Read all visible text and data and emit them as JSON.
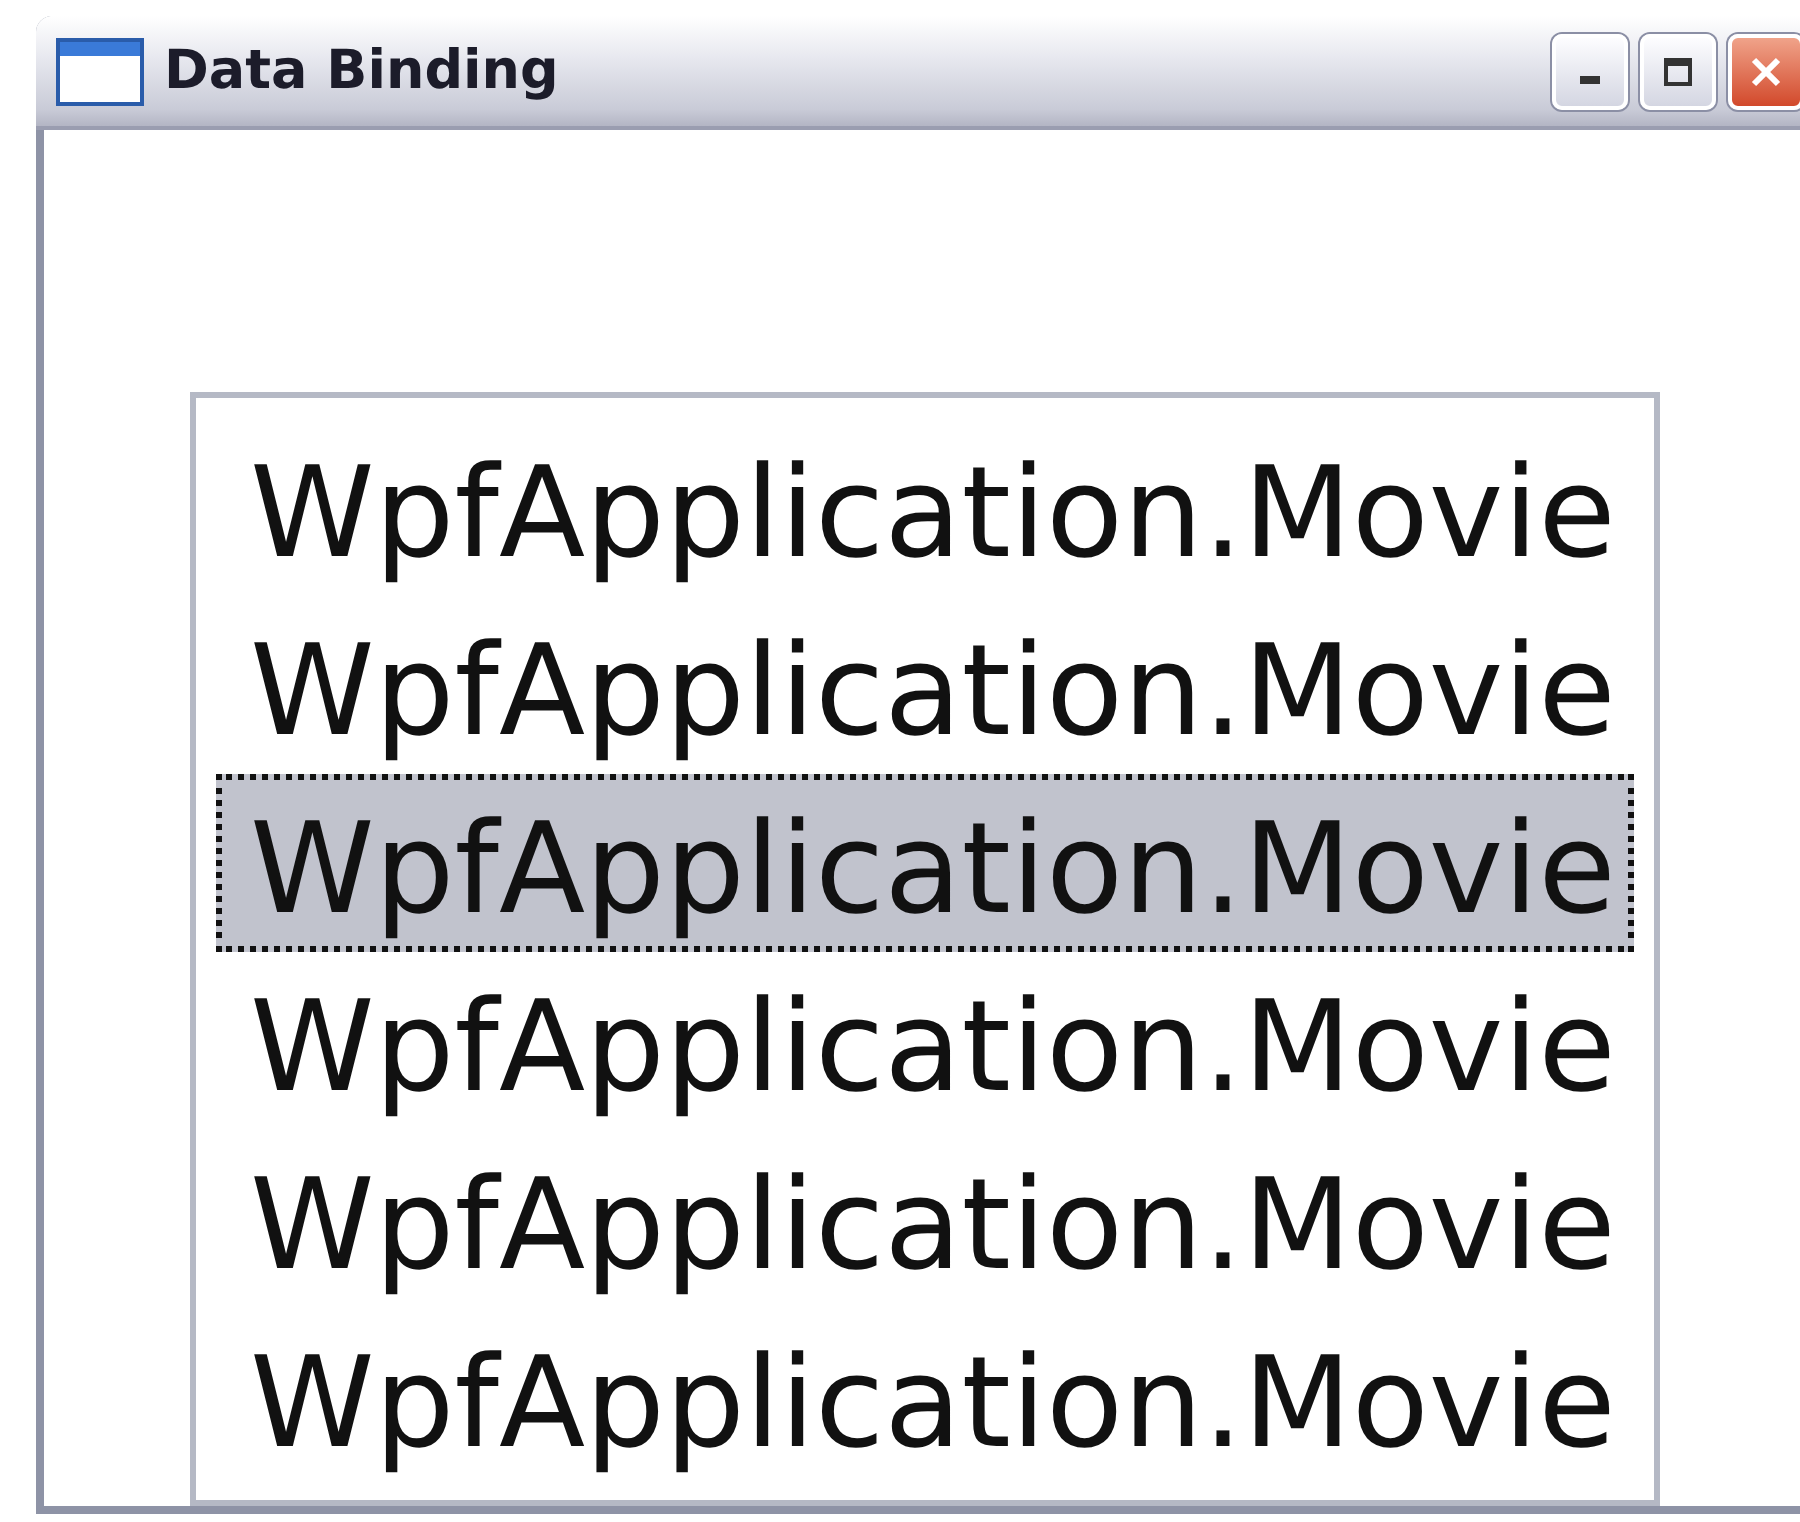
{
  "window": {
    "title": "Data Binding"
  },
  "list": {
    "items": [
      {
        "text": "WpfApplication.Movie",
        "selected": false
      },
      {
        "text": "WpfApplication.Movie",
        "selected": false
      },
      {
        "text": "WpfApplication.Movie",
        "selected": true
      },
      {
        "text": "WpfApplication.Movie",
        "selected": false
      },
      {
        "text": "WpfApplication.Movie",
        "selected": false
      },
      {
        "text": "WpfApplication.Movie",
        "selected": false
      }
    ]
  }
}
